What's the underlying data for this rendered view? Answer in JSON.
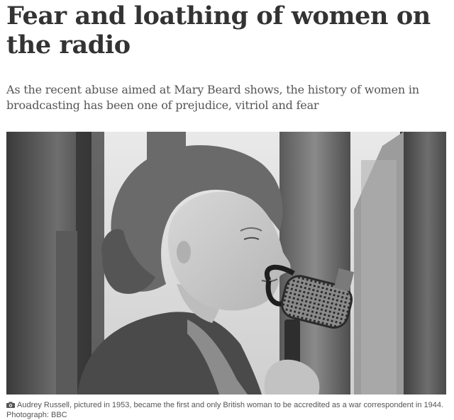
{
  "article": {
    "headline": "Fear and loathing of women on the radio",
    "standfirst": "As the recent abuse aimed at Mary Beard shows, the history of women in broadcasting has been one of prejudice, vitriol and fear",
    "caption": {
      "icon": "camera-icon",
      "text": "Audrey Russell, pictured in 1953, became the first and only British woman to be accredited as a war correspondent in 1944.",
      "credit": "Photograph: BBC"
    }
  }
}
